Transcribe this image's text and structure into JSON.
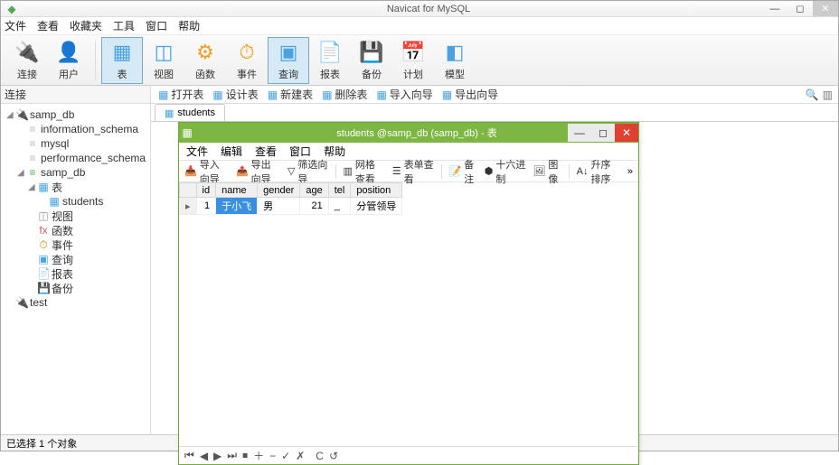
{
  "title": "Navicat for MySQL",
  "menubar": [
    "文件",
    "查看",
    "收藏夹",
    "工具",
    "窗口",
    "帮助"
  ],
  "ribbon": [
    {
      "icon": "🔌",
      "label": "连接",
      "color": "#f5b400"
    },
    {
      "icon": "👤",
      "label": "用户",
      "color": "#f5b400"
    }
  ],
  "ribbon2": [
    {
      "icon": "▦",
      "label": "表",
      "active": true,
      "color": "#4aa3df"
    },
    {
      "icon": "◫",
      "label": "视图",
      "color": "#4aa3df"
    },
    {
      "icon": "⚙",
      "label": "函数",
      "color": "#f0a020"
    },
    {
      "icon": "⏱",
      "label": "事件",
      "color": "#f0a020"
    },
    {
      "icon": "▣",
      "label": "查询",
      "active": true,
      "color": "#4aa3df"
    },
    {
      "icon": "📄",
      "label": "报表",
      "color": "#f0a020"
    },
    {
      "icon": "💾",
      "label": "备份",
      "color": "#4aa3df"
    },
    {
      "icon": "📅",
      "label": "计划",
      "color": "#4aa3df"
    },
    {
      "icon": "◧",
      "label": "模型",
      "color": "#4aa3df"
    }
  ],
  "sectitle": "连接",
  "sectoolbar": [
    "打开表",
    "设计表",
    "新建表",
    "删除表",
    "导入向导",
    "导出向导"
  ],
  "tree": [
    {
      "d": 1,
      "tw": "◢",
      "icon": "🔌",
      "label": "samp_db",
      "color": "#5a5"
    },
    {
      "d": 2,
      "tw": "",
      "icon": "≡",
      "label": "information_schema",
      "color": "#bbb"
    },
    {
      "d": 2,
      "tw": "",
      "icon": "≡",
      "label": "mysql",
      "color": "#bbb"
    },
    {
      "d": 2,
      "tw": "",
      "icon": "≡",
      "label": "performance_schema",
      "color": "#bbb"
    },
    {
      "d": 2,
      "tw": "◢",
      "icon": "≡",
      "label": "samp_db",
      "color": "#5a5"
    },
    {
      "d": 3,
      "tw": "◢",
      "icon": "▦",
      "label": "表",
      "color": "#4aa3df"
    },
    {
      "d": 4,
      "tw": "",
      "icon": "▦",
      "label": "students",
      "color": "#4aa3df"
    },
    {
      "d": 3,
      "tw": "",
      "icon": "◫",
      "label": "视图",
      "color": "#999",
      "prefix": "oo"
    },
    {
      "d": 3,
      "tw": "",
      "icon": "fx",
      "label": "函数",
      "color": "#c66",
      "prefix": ""
    },
    {
      "d": 3,
      "tw": "",
      "icon": "⏱",
      "label": "事件",
      "color": "#a80"
    },
    {
      "d": 3,
      "tw": "",
      "icon": "▣",
      "label": "查询",
      "color": "#4aa3df"
    },
    {
      "d": 3,
      "tw": "",
      "icon": "📄",
      "label": "报表",
      "color": "#a80"
    },
    {
      "d": 3,
      "tw": "",
      "icon": "💾",
      "label": "备份",
      "color": "#4aa3df"
    },
    {
      "d": 1,
      "tw": "",
      "icon": "🔌",
      "label": "test",
      "color": "#bbb"
    }
  ],
  "tabs": [
    {
      "label": "students",
      "icon": "▦"
    }
  ],
  "child": {
    "title": "students @samp_db (samp_db) - 表",
    "menubar": [
      "文件",
      "编辑",
      "查看",
      "窗口",
      "帮助"
    ],
    "toolbar": [
      {
        "icon": "📥",
        "label": "导入向导"
      },
      {
        "icon": "📤",
        "label": "导出向导"
      },
      {
        "icon": "▽",
        "label": "筛选向导"
      },
      {
        "sep": true
      },
      {
        "icon": "▥",
        "label": "网格查看"
      },
      {
        "icon": "☰",
        "label": "表单查看"
      },
      {
        "sep": true
      },
      {
        "icon": "📝",
        "label": "备注"
      },
      {
        "icon": "⬢",
        "label": "十六进制"
      },
      {
        "icon": "🖼",
        "label": "图像"
      },
      {
        "sep": true
      },
      {
        "icon": "A↓",
        "label": "升序排序"
      }
    ],
    "columns": [
      "id",
      "name",
      "gender",
      "age",
      "tel",
      "position"
    ],
    "rows": [
      {
        "id": "1",
        "name": "于小飞",
        "gender": "男",
        "age": "21",
        "tel": "_",
        "position": "分管领导"
      }
    ],
    "selected_col": "name",
    "nav": [
      "⏮",
      "◀",
      "▶",
      "⏭",
      "⏹",
      "＋",
      "−",
      "✓",
      "✗",
      "",
      "C",
      "↺"
    ]
  },
  "status": "已选择 1 个对象"
}
